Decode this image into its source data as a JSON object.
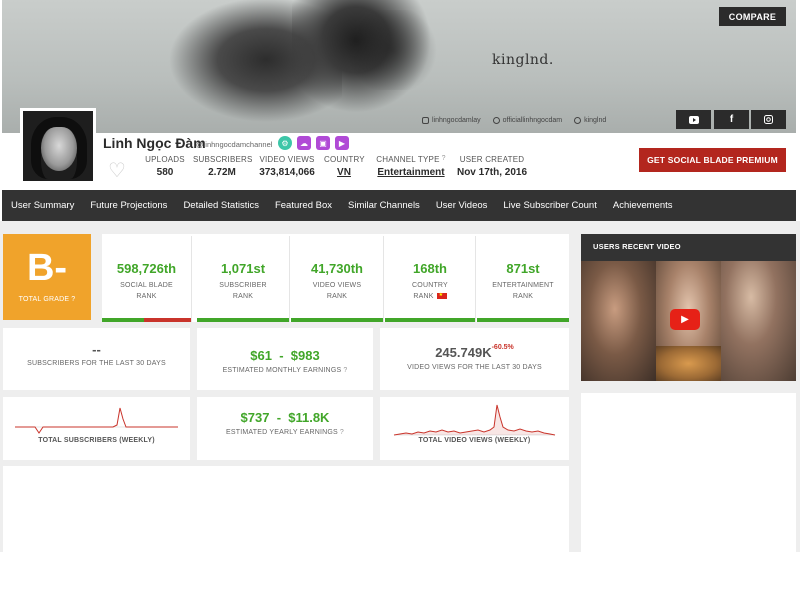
{
  "banner": {
    "wordmark": "kinglnd.",
    "social_row": [
      "linhngocdamlay",
      "officiallinhngocdam",
      "kinglnd"
    ],
    "compare_label": "COMPARE",
    "social_buttons": [
      "youtube-icon",
      "facebook-icon",
      "instagram-icon"
    ]
  },
  "channel": {
    "name": "Linh Ngọc Đàm",
    "handle": "@linhngocdamchannel",
    "badges": [
      {
        "icon": "settings-icon",
        "color": "#3dc6a8"
      },
      {
        "icon": "cloud-icon",
        "color": "#b04ad6"
      },
      {
        "icon": "image-icon",
        "color": "#b04ad6"
      },
      {
        "icon": "video-icon",
        "color": "#b04ad6"
      }
    ]
  },
  "stats": {
    "uploads_label": "UPLOADS",
    "uploads": "580",
    "subscribers_label": "SUBSCRIBERS",
    "subscribers": "2.72M",
    "views_label": "VIDEO VIEWS",
    "views": "373,814,066",
    "country_label": "COUNTRY",
    "country": "VN",
    "type_label": "CHANNEL TYPE",
    "type": "Entertainment",
    "created_label": "USER CREATED",
    "created": "Nov 17th, 2016"
  },
  "premium_label": "GET SOCIAL BLADE PREMIUM",
  "nav": [
    "User Summary",
    "Future Projections",
    "Detailed Statistics",
    "Featured Box",
    "Similar Channels",
    "User Videos",
    "Live Subscriber Count",
    "Achievements"
  ],
  "grade": {
    "value": "B-",
    "label": "TOTAL GRADE"
  },
  "ranks": [
    {
      "value": "598,726th",
      "label1": "SOCIAL BLADE",
      "label2": "RANK",
      "green_fraction": 0.47
    },
    {
      "value": "1,071st",
      "label1": "SUBSCRIBER",
      "label2": "RANK",
      "green_fraction": 1.0
    },
    {
      "value": "41,730th",
      "label1": "VIDEO VIEWS",
      "label2": "RANK",
      "green_fraction": 1.0
    },
    {
      "value": "168th",
      "label1": "COUNTRY",
      "label2": "RANK",
      "green_fraction": 1.0
    },
    {
      "value": "871st",
      "label1": "ENTERTAINMENT",
      "label2": "RANK",
      "green_fraction": 1.0
    }
  ],
  "row2": {
    "subs30": "--",
    "subs30_label": "SUBSCRIBERS FOR THE LAST 30 DAYS",
    "monthly": "$61  -  $983",
    "monthly_label": "ESTIMATED MONTHLY EARNINGS",
    "views30": "245.749K",
    "views30_change": "-60.5%",
    "views30_label": "VIDEO VIEWS FOR THE LAST 30 DAYS"
  },
  "row3": {
    "subs_weekly_label": "TOTAL SUBSCRIBERS (WEEKLY)",
    "yearly": "$737  -  $11.8K",
    "yearly_label": "ESTIMATED YEARLY EARNINGS",
    "views_weekly_label": "TOTAL VIDEO VIEWS (WEEKLY)"
  },
  "recent_video_title": "USERS RECENT VIDEO",
  "colors": {
    "green": "#41a629",
    "red": "#c9342b",
    "grade": "#f0a32b",
    "nav": "#333333",
    "premium": "#b3261e"
  }
}
